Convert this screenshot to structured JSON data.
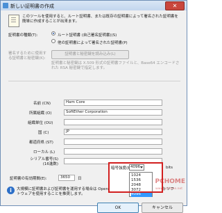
{
  "window": {
    "title": "新しい証明書の作成",
    "close_label": "✕"
  },
  "description": "このツールを使用すると、ルート証明書、または既存の証明書によって署名された証明書を簡単に作成することが出来ます。",
  "cert_type": {
    "label": "証明書の種類(T):",
    "option_root": "ルート証明書 (自己署名証明書)(S)",
    "option_signed": "他の証明書によって署名された証明書(P)"
  },
  "signing_cert": {
    "label": "署名するために使用する証明書と秘密鍵(K):",
    "button": "証明書と秘密鍵を読み込み(L)",
    "note": "証明書と秘密鍵は X.509 形式の証明書ファイルと、Base64 エンコードされた RSA 秘密鍵で指定します。"
  },
  "fields": [
    {
      "label": "名前 (CN)",
      "value": "Ham Core"
    },
    {
      "label": "所属組織 (O)",
      "value": "SoftEther Corporation"
    },
    {
      "label": "組織単位 (OU)",
      "value": ""
    },
    {
      "label": "国 (C)",
      "value": "JP"
    },
    {
      "label": "都道府県 (ST)",
      "value": ""
    },
    {
      "label": "ローカル (L)",
      "value": ""
    },
    {
      "label": "シリアル番号(S) (16進数)",
      "value": ""
    }
  ],
  "validity": {
    "label": "証明書の有効期間(E):",
    "value": "3650",
    "unit": "日"
  },
  "key_strength": {
    "label": "暗号強度(B):",
    "selected": "4096",
    "unit": "bits",
    "options": [
      "1024",
      "1536",
      "2048",
      "3072",
      "4096"
    ]
  },
  "info_text_1": "大規模に証明書および証明書を運用する場合は OpenSSL などの専用の CA (証明機関) ソフトウェアを使用することを推奨します。",
  "buttons": {
    "ok": "OK",
    "cancel": "キャンセル"
  },
  "watermark": {
    "brand": "PCHOME",
    "url": "www.pchome.net"
  }
}
